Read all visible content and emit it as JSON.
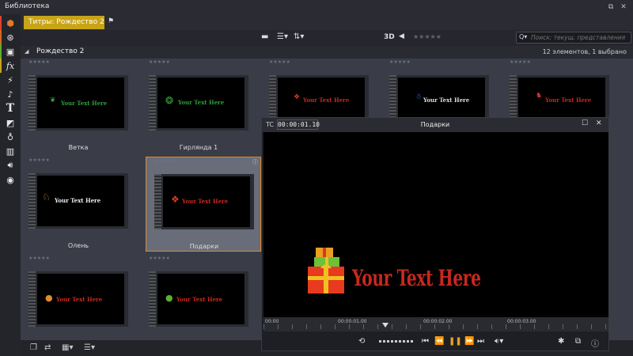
{
  "app": {
    "title": "Библиотека"
  },
  "tabs": {
    "active": "Титры: Рождество 2"
  },
  "toolbar": {
    "label_3d": "3D",
    "rating": "★★★★★",
    "search_icon": "Q▾",
    "search_placeholder": "Поиск: текущ. представления"
  },
  "folder": {
    "name": "Рождество 2",
    "count": "12 элементов, 1 выбрано"
  },
  "grid": {
    "stars": "★★★★★",
    "items": [
      {
        "label": "Ветка",
        "text": "Your Text Here"
      },
      {
        "label": "Гирлянда 1",
        "text": "Your Text Here"
      },
      {
        "label": "",
        "text": "Your Text Here"
      },
      {
        "label": "",
        "text": "Your Text Here"
      },
      {
        "label": "",
        "text": "Your Text Here"
      },
      {
        "label": "Олень",
        "text": "Your Text Here"
      },
      {
        "label": "Подарки",
        "text": "Your Text Here"
      },
      {
        "label": "",
        "text": "Your Text Here"
      },
      {
        "label": "",
        "text": "Your Text Here"
      }
    ]
  },
  "player": {
    "tc_label": "TC",
    "timecode": "00:00:01.10",
    "title": "Подарки",
    "overlay_text": "Your Text Here",
    "timeline_labels": [
      "00:00",
      "00:00:01.00",
      "00:00:02.00",
      "00:00:03.00"
    ]
  },
  "colors": {
    "accent": "#c8a417",
    "selection": "#e08a2c",
    "title_text": "#c8281e"
  }
}
